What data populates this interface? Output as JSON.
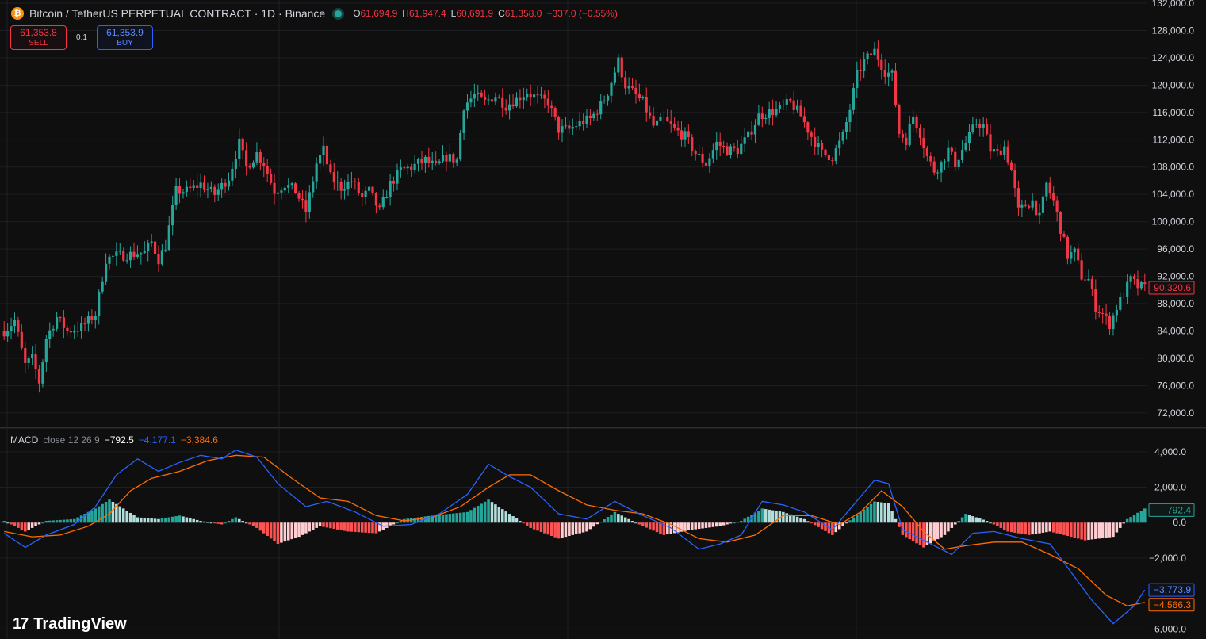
{
  "header": {
    "title": "Bitcoin / TetherUS PERPETUAL CONTRACT · 1D · Binance",
    "coin_glyph": "₿",
    "ohlc": [
      {
        "key": "O",
        "value": "61,694.9"
      },
      {
        "key": "H",
        "value": "61,947.4"
      },
      {
        "key": "L",
        "value": "60,691.9"
      },
      {
        "key": "C",
        "value": "61,358.0"
      },
      {
        "key": "",
        "value": "−337.0 (−0.55%)"
      }
    ]
  },
  "trade": {
    "sell_price": "61,353.8",
    "sell_label": "SELL",
    "spread": "0.1",
    "buy_price": "61,353.9",
    "buy_label": "BUY"
  },
  "macd_legend": {
    "name": "MACD",
    "params": "close 12 26 9",
    "hist": "−792.5",
    "macd": "−4,177.1",
    "signal": "−3,384.6"
  },
  "logo": {
    "mark": "17",
    "text": "TradingView"
  },
  "colors": {
    "bg": "#0f0f0f",
    "grid": "#1e1f23",
    "up": "#26a69a",
    "down": "#f23645",
    "hist_up_strong": "#26a69a",
    "hist_up_weak": "#b2dfdb",
    "hist_down_strong": "#ff5252",
    "hist_down_weak": "#ffcdd2",
    "macd_line": "#2962ff",
    "signal_line": "#ff6d00"
  },
  "chart_data": [
    {
      "type": "candlestick",
      "ylim": [
        70000,
        132000
      ],
      "y_ticks": [
        "72,000.0",
        "76,000.0",
        "80,000.0",
        "84,000.0",
        "88,000.0",
        "92,000.0",
        "96,000.0",
        "100,000.0",
        "104,000.0",
        "108,000.0",
        "112,000.0",
        "116,000.0",
        "120,000.0",
        "124,000.0",
        "128,000.0",
        "132,000.0"
      ],
      "last_price": 90320.6,
      "last_price_label": "90,320.6",
      "close_path": [
        [
          0,
          84000
        ],
        [
          3,
          85500
        ],
        [
          6,
          79000
        ],
        [
          8,
          80000
        ],
        [
          10,
          76500
        ],
        [
          12,
          83000
        ],
        [
          15,
          86000
        ],
        [
          18,
          84000
        ],
        [
          22,
          84500
        ],
        [
          26,
          86500
        ],
        [
          29,
          94500
        ],
        [
          32,
          95000
        ],
        [
          36,
          95200
        ],
        [
          40,
          95500
        ],
        [
          42,
          97000
        ],
        [
          44,
          94500
        ],
        [
          46,
          96500
        ],
        [
          49,
          104500
        ],
        [
          52,
          104500
        ],
        [
          56,
          105500
        ],
        [
          60,
          104000
        ],
        [
          64,
          106500
        ],
        [
          67,
          111500
        ],
        [
          69,
          108000
        ],
        [
          72,
          110000
        ],
        [
          74,
          108500
        ],
        [
          77,
          104500
        ],
        [
          80,
          105500
        ],
        [
          83,
          104500
        ],
        [
          86,
          101500
        ],
        [
          89,
          108500
        ],
        [
          91,
          110500
        ],
        [
          93,
          106500
        ],
        [
          96,
          105000
        ],
        [
          99,
          106000
        ],
        [
          102,
          103500
        ],
        [
          104,
          104500
        ],
        [
          107,
          101500
        ],
        [
          110,
          105500
        ],
        [
          113,
          107500
        ],
        [
          116,
          108000
        ],
        [
          120,
          109000
        ],
        [
          123,
          108000
        ],
        [
          126,
          109500
        ],
        [
          129,
          109000
        ],
        [
          131,
          117000
        ],
        [
          134,
          118500
        ],
        [
          137,
          117500
        ],
        [
          140,
          118500
        ],
        [
          143,
          117000
        ],
        [
          146,
          118000
        ],
        [
          149,
          119000
        ],
        [
          152,
          118000
        ],
        [
          155,
          117500
        ],
        [
          158,
          113500
        ],
        [
          161,
          113500
        ],
        [
          164,
          114500
        ],
        [
          167,
          115000
        ],
        [
          170,
          117000
        ],
        [
          172,
          119000
        ],
        [
          175,
          123500
        ],
        [
          177,
          120000
        ],
        [
          179,
          119000
        ],
        [
          182,
          117500
        ],
        [
          185,
          114000
        ],
        [
          188,
          115000
        ],
        [
          191,
          113500
        ],
        [
          194,
          112500
        ],
        [
          197,
          110000
        ],
        [
          200,
          108500
        ],
        [
          203,
          111500
        ],
        [
          206,
          110500
        ],
        [
          209,
          110500
        ],
        [
          212,
          112500
        ],
        [
          215,
          115500
        ],
        [
          218,
          116000
        ],
        [
          221,
          116500
        ],
        [
          224,
          117500
        ],
        [
          227,
          115500
        ],
        [
          230,
          112500
        ],
        [
          233,
          110000
        ],
        [
          236,
          109500
        ],
        [
          239,
          112500
        ],
        [
          241,
          116500
        ],
        [
          243,
          121500
        ],
        [
          245,
          123500
        ],
        [
          248,
          125000
        ],
        [
          251,
          122000
        ],
        [
          253,
          121500
        ],
        [
          255,
          113000
        ],
        [
          257,
          112000
        ],
        [
          259,
          115500
        ],
        [
          261,
          113000
        ],
        [
          263,
          109500
        ],
        [
          265,
          107500
        ],
        [
          267,
          108500
        ],
        [
          269,
          110500
        ],
        [
          271,
          108500
        ],
        [
          273,
          110500
        ],
        [
          275,
          112500
        ],
        [
          277,
          114500
        ],
        [
          279,
          114000
        ],
        [
          281,
          110500
        ],
        [
          283,
          110000
        ],
        [
          285,
          111000
        ],
        [
          287,
          107500
        ],
        [
          289,
          101500
        ],
        [
          291,
          102500
        ],
        [
          293,
          103000
        ],
        [
          295,
          100500
        ],
        [
          297,
          105500
        ],
        [
          299,
          103000
        ],
        [
          301,
          99000
        ],
        [
          303,
          95000
        ],
        [
          305,
          95500
        ],
        [
          307,
          92000
        ],
        [
          309,
          91500
        ],
        [
          311,
          87500
        ],
        [
          313,
          86500
        ],
        [
          315,
          85000
        ],
        [
          317,
          87500
        ],
        [
          319,
          89500
        ],
        [
          321,
          91500
        ],
        [
          323,
          90500
        ],
        [
          325,
          90300
        ]
      ]
    },
    {
      "type": "line",
      "title": "MACD close 12 26 9",
      "ylim": [
        -6300,
        4800
      ],
      "y_ticks": [
        "−6,000.0",
        "−2,000.0",
        "0.0",
        "2,000.0",
        "4,000.0"
      ],
      "hist_last_label": "792.4",
      "macd_last_label": "−3,773.9",
      "signal_last_label": "−4,566.3",
      "series": [
        {
          "role": "macd",
          "points": [
            [
              0,
              -600
            ],
            [
              6,
              -1400
            ],
            [
              12,
              -700
            ],
            [
              20,
              -100
            ],
            [
              26,
              900
            ],
            [
              32,
              2700
            ],
            [
              38,
              3600
            ],
            [
              44,
              2900
            ],
            [
              50,
              3400
            ],
            [
              56,
              3800
            ],
            [
              62,
              3600
            ],
            [
              66,
              4100
            ],
            [
              72,
              3700
            ],
            [
              78,
              2200
            ],
            [
              86,
              900
            ],
            [
              92,
              1200
            ],
            [
              100,
              600
            ],
            [
              108,
              -200
            ],
            [
              116,
              -100
            ],
            [
              124,
              500
            ],
            [
              132,
              1600
            ],
            [
              138,
              3300
            ],
            [
              144,
              2600
            ],
            [
              150,
              2000
            ],
            [
              158,
              500
            ],
            [
              166,
              200
            ],
            [
              174,
              1200
            ],
            [
              182,
              400
            ],
            [
              190,
              -300
            ],
            [
              198,
              -1500
            ],
            [
              204,
              -1200
            ],
            [
              210,
              -700
            ],
            [
              216,
              1200
            ],
            [
              222,
              1000
            ],
            [
              228,
              600
            ],
            [
              236,
              -400
            ],
            [
              242,
              1000
            ],
            [
              248,
              2400
            ],
            [
              252,
              2200
            ],
            [
              256,
              -400
            ],
            [
              264,
              -1200
            ],
            [
              270,
              -1800
            ],
            [
              276,
              -600
            ],
            [
              282,
              -500
            ],
            [
              290,
              -900
            ],
            [
              298,
              -1200
            ],
            [
              304,
              -2800
            ],
            [
              310,
              -4400
            ],
            [
              316,
              -5700
            ],
            [
              322,
              -4700
            ],
            [
              325,
              -3800
            ]
          ]
        },
        {
          "role": "signal",
          "points": [
            [
              0,
              -500
            ],
            [
              8,
              -800
            ],
            [
              16,
              -700
            ],
            [
              24,
              -200
            ],
            [
              30,
              500
            ],
            [
              36,
              1800
            ],
            [
              42,
              2500
            ],
            [
              50,
              2900
            ],
            [
              58,
              3500
            ],
            [
              66,
              3800
            ],
            [
              74,
              3700
            ],
            [
              82,
              2500
            ],
            [
              90,
              1400
            ],
            [
              98,
              1200
            ],
            [
              106,
              400
            ],
            [
              114,
              100
            ],
            [
              122,
              300
            ],
            [
              130,
              900
            ],
            [
              138,
              2000
            ],
            [
              144,
              2700
            ],
            [
              150,
              2700
            ],
            [
              158,
              1800
            ],
            [
              166,
              1000
            ],
            [
              174,
              700
            ],
            [
              182,
              500
            ],
            [
              190,
              -100
            ],
            [
              198,
              -900
            ],
            [
              206,
              -1100
            ],
            [
              214,
              -700
            ],
            [
              222,
              400
            ],
            [
              230,
              400
            ],
            [
              238,
              -100
            ],
            [
              244,
              600
            ],
            [
              250,
              1800
            ],
            [
              256,
              900
            ],
            [
              262,
              -500
            ],
            [
              268,
              -1500
            ],
            [
              274,
              -1300
            ],
            [
              282,
              -1100
            ],
            [
              290,
              -1100
            ],
            [
              298,
              -1800
            ],
            [
              306,
              -2600
            ],
            [
              314,
              -4100
            ],
            [
              320,
              -4700
            ],
            [
              325,
              -4500
            ]
          ]
        },
        {
          "role": "hist",
          "points": [
            [
              0,
              100
            ],
            [
              6,
              -500
            ],
            [
              12,
              100
            ],
            [
              20,
              200
            ],
            [
              26,
              800
            ],
            [
              30,
              1300
            ],
            [
              34,
              800
            ],
            [
              38,
              300
            ],
            [
              44,
              200
            ],
            [
              50,
              400
            ],
            [
              56,
              100
            ],
            [
              62,
              -100
            ],
            [
              66,
              300
            ],
            [
              72,
              -300
            ],
            [
              78,
              -1200
            ],
            [
              84,
              -800
            ],
            [
              90,
              -200
            ],
            [
              98,
              -500
            ],
            [
              106,
              -600
            ],
            [
              114,
              200
            ],
            [
              122,
              400
            ],
            [
              132,
              600
            ],
            [
              138,
              1300
            ],
            [
              144,
              500
            ],
            [
              150,
              -300
            ],
            [
              158,
              -900
            ],
            [
              166,
              -500
            ],
            [
              174,
              600
            ],
            [
              182,
              -200
            ],
            [
              188,
              -700
            ],
            [
              196,
              -400
            ],
            [
              204,
              -200
            ],
            [
              210,
              100
            ],
            [
              216,
              800
            ],
            [
              222,
              600
            ],
            [
              228,
              200
            ],
            [
              236,
              -700
            ],
            [
              242,
              300
            ],
            [
              248,
              1200
            ],
            [
              252,
              1100
            ],
            [
              256,
              -700
            ],
            [
              262,
              -1400
            ],
            [
              268,
              -700
            ],
            [
              274,
              500
            ],
            [
              280,
              100
            ],
            [
              286,
              -500
            ],
            [
              292,
              -700
            ],
            [
              298,
              -500
            ],
            [
              304,
              -800
            ],
            [
              308,
              -1000
            ],
            [
              312,
              -900
            ],
            [
              316,
              -800
            ],
            [
              320,
              200
            ],
            [
              325,
              800
            ]
          ]
        }
      ]
    }
  ]
}
